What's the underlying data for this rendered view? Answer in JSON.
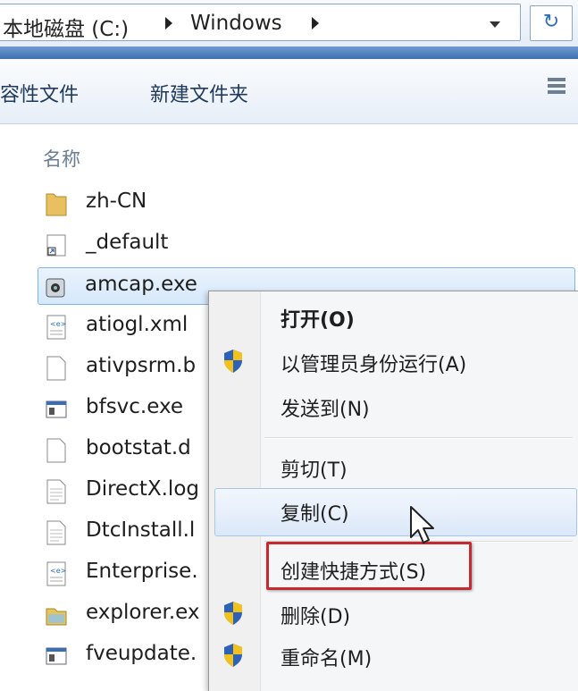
{
  "address_bar": {
    "crumbs": [
      "本地磁盘 (C:)",
      "Windows"
    ],
    "refresh_glyph": "↻"
  },
  "toolbar": {
    "properties_label": "容性文件",
    "new_folder_label": "新建文件夹"
  },
  "file_list": {
    "column_name": "名称",
    "items": [
      {
        "name": "zh-CN",
        "icon": "folder-icon"
      },
      {
        "name": "_default",
        "icon": "shortcut-icon"
      },
      {
        "name": "amcap.exe",
        "icon": "camera-app-icon",
        "selected": true
      },
      {
        "name": "atiogl.xml",
        "icon": "xml-file-icon"
      },
      {
        "name": "ativpsrm.b",
        "icon": "blank-file-icon"
      },
      {
        "name": "bfsvc.exe",
        "icon": "exe-icon"
      },
      {
        "name": "bootstat.d",
        "icon": "blank-file-icon"
      },
      {
        "name": "DirectX.log",
        "icon": "text-file-icon"
      },
      {
        "name": "DtcInstall.l",
        "icon": "text-file-icon"
      },
      {
        "name": "Enterprise.",
        "icon": "xml-file-icon"
      },
      {
        "name": "explorer.ex",
        "icon": "explorer-app-icon"
      },
      {
        "name": "fveupdate.",
        "icon": "exe-icon"
      }
    ]
  },
  "context_menu": {
    "items": [
      {
        "label": "打开(O)",
        "bold": true,
        "shield": false
      },
      {
        "label": "以管理员身份运行(A)",
        "shield": true
      },
      {
        "label": "发送到(N)",
        "shield": false
      },
      {
        "label": "剪切(T)",
        "shield": false
      },
      {
        "label": "复制(C)",
        "shield": false,
        "hovered": true
      },
      {
        "label": "创建快捷方式(S)",
        "shield": false,
        "highlighted": true
      },
      {
        "label": "删除(D)",
        "shield": true
      },
      {
        "label": "重命名(M)",
        "shield": true
      }
    ]
  },
  "colors": {
    "accent_blue": "#3f6fb0",
    "highlight_red": "#c52a30",
    "selection": "#d6e8fb"
  }
}
